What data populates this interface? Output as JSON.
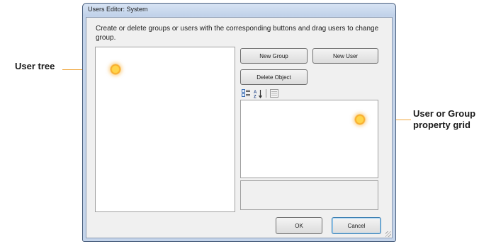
{
  "window": {
    "title": "Users Editor: System"
  },
  "instructions": "Create or delete groups or users with the corresponding buttons and drag users to change group.",
  "buttons": {
    "new_group": "New Group",
    "new_user": "New User",
    "delete_object": "Delete Object",
    "ok": "OK",
    "cancel": "Cancel"
  },
  "toolbar": {
    "icons": [
      "categorized-icon",
      "alphabetical-sort-icon",
      "property-pages-icon"
    ]
  },
  "callouts": {
    "user_tree": "User tree",
    "property_grid": "User or Group property grid"
  },
  "colors": {
    "callout_accent": "#f6a623",
    "title_bar": "#c4d4ea"
  }
}
